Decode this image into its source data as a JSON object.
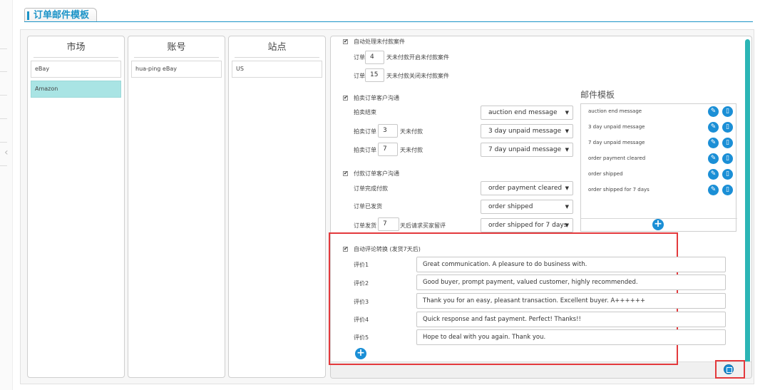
{
  "page": {
    "title": "订单邮件模板"
  },
  "columns": {
    "market": {
      "header": "市场",
      "items": [
        "eBay",
        "Amazon"
      ]
    },
    "account": {
      "header": "账号",
      "items": [
        "hua-ping eBay"
      ]
    },
    "site": {
      "header": "站点",
      "items": [
        "US"
      ]
    }
  },
  "auto_unpaid": {
    "label": "自动处理未付款案件",
    "checked": "✔",
    "row1": {
      "prefix": "订单",
      "value": "4",
      "suffix": "天未付款开启未付款案件"
    },
    "row2": {
      "prefix": "订单",
      "value": "15",
      "suffix": "天未付款关闭未付款案件"
    }
  },
  "auction": {
    "label": "拍卖订单客户沟通",
    "checked": "✔",
    "end": {
      "label": "拍卖结束",
      "select": "auction end message"
    },
    "unpaid3": {
      "prefix": "拍卖订单",
      "value": "3",
      "suffix": "天未付款",
      "select": "3 day unpaid message"
    },
    "unpaid7": {
      "prefix": "拍卖订单",
      "value": "7",
      "suffix": "天未付款",
      "select": "7 day unpaid message"
    }
  },
  "paid": {
    "label": "付款订单客户沟通",
    "checked": "✔",
    "cleared": {
      "label": "订单完成付款",
      "select": "order payment cleared"
    },
    "shipped": {
      "label": "订单已发货",
      "select": "order shipped"
    },
    "feedback": {
      "prefix": "订单发货",
      "value": "7",
      "suffix": "天后请求买家留评",
      "select": "order shipped for 7 days"
    }
  },
  "templates": {
    "title": "邮件模板",
    "items": [
      "auction end message",
      "3 day unpaid message",
      "7 day unpaid message",
      "order payment cleared",
      "order shipped",
      "order shipped for 7 days"
    ]
  },
  "auto_review": {
    "label": "自动评论转换 (发货7天后)",
    "checked": "✔",
    "reviews": [
      {
        "label": "评价1",
        "text": "Great communication. A pleasure to do business with."
      },
      {
        "label": "评价2",
        "text": "Good buyer, prompt payment, valued customer, highly recommended."
      },
      {
        "label": "评价3",
        "text": "Thank you for an easy, pleasant transaction. Excellent buyer. A++++++"
      },
      {
        "label": "评价4",
        "text": "Quick response and fast payment. Perfect! Thanks!!"
      },
      {
        "label": "评价5",
        "text": "Hope to deal with you again. Thank you."
      }
    ]
  },
  "colors": {
    "accent": "#1b93c7",
    "selected": "#a9e4e4",
    "highlight": "#e3393c",
    "icon": "#1b8fd6"
  }
}
